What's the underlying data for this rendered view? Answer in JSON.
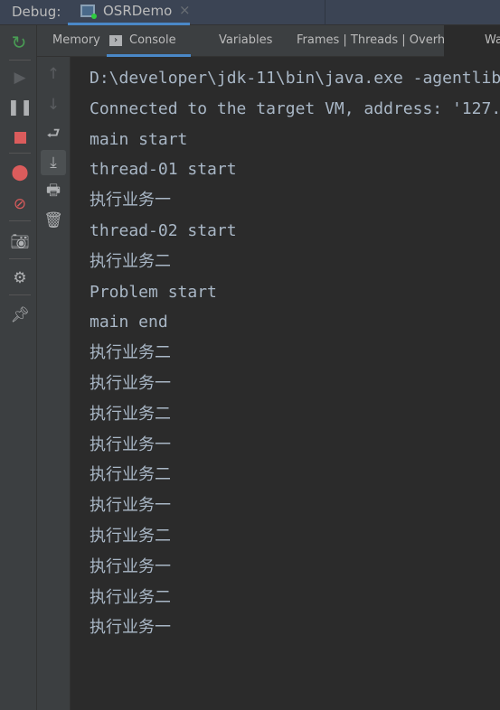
{
  "header": {
    "label": "Debug:",
    "tab_name": "OSRDemo",
    "close": "×"
  },
  "tabs": [
    {
      "label": "Memory"
    },
    {
      "label": "Console",
      "active": true
    },
    {
      "label": "Variables"
    },
    {
      "label": "Frames | Threads | Overhead"
    },
    {
      "label": "Wa"
    }
  ],
  "toolbar_icons": [
    "rerun-icon",
    "resume-icon",
    "pause-icon",
    "stop-icon",
    "view-breakpoints-icon",
    "mute-breakpoints-icon",
    "camera-icon",
    "settings-icon",
    "pin-icon"
  ],
  "console_toolbar_icons": [
    "up-arrow-icon",
    "down-arrow-icon",
    "soft-wrap-icon",
    "scroll-to-end-icon",
    "print-icon",
    "trash-icon"
  ],
  "console": {
    "lines": [
      "D:\\developer\\jdk-11\\bin\\java.exe -agentlib",
      "Connected to the target VM, address: '127.",
      "main start",
      "thread-01 start",
      "执行业务一",
      "thread-02 start",
      "执行业务二",
      "Problem start",
      "main end",
      "执行业务二",
      "执行业务一",
      "执行业务二",
      "执行业务一",
      "执行业务二",
      "执行业务一",
      "执行业务二",
      "执行业务一",
      "执行业务二",
      "执行业务一"
    ]
  },
  "colors": {
    "accent": "#4a88c7",
    "stop": "#db5c5c",
    "rerun": "#499c54",
    "text": "#a9b7c6"
  }
}
